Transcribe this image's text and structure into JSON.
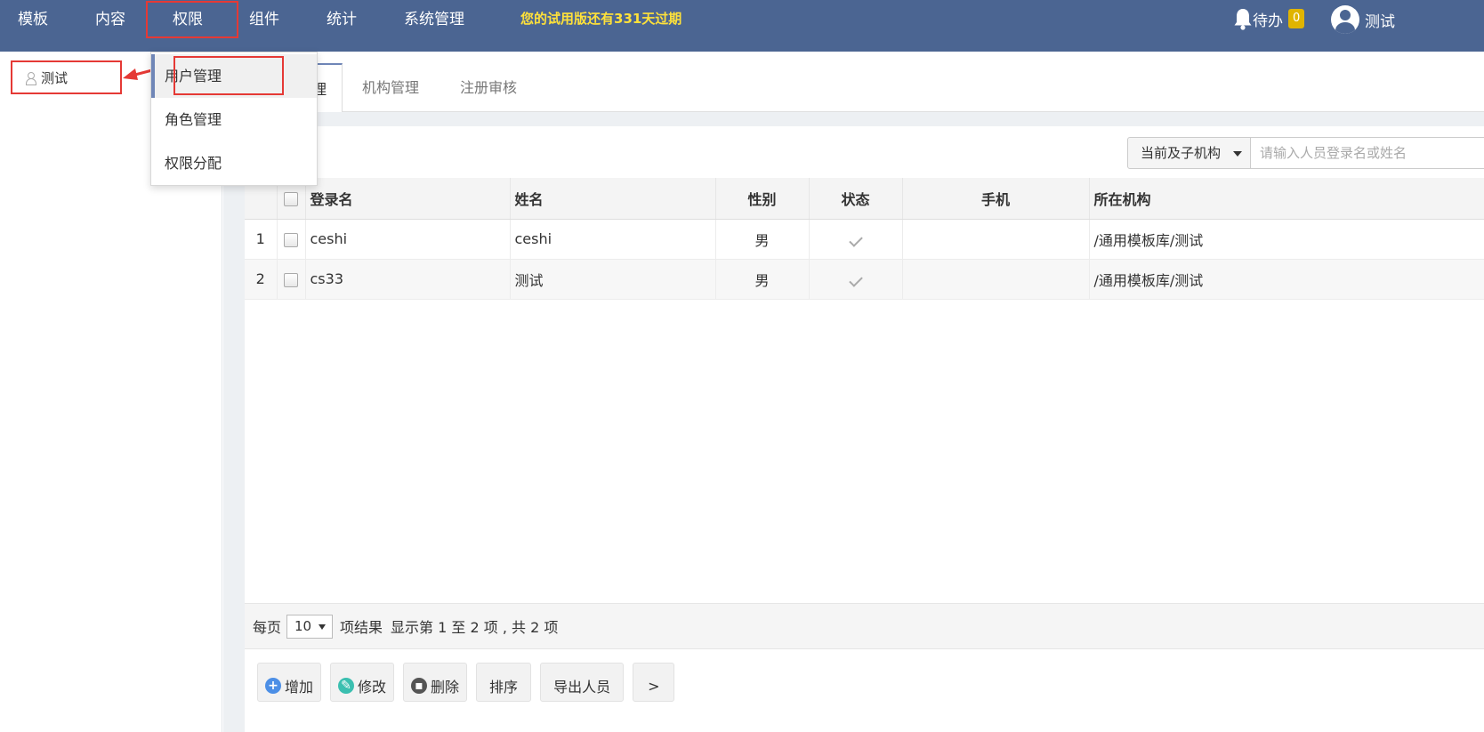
{
  "nav": {
    "items": [
      {
        "label": "模板"
      },
      {
        "label": "内容"
      },
      {
        "label": "权限"
      },
      {
        "label": "组件"
      },
      {
        "label": "统计"
      },
      {
        "label": "系统管理"
      }
    ],
    "trial_notice": "您的试用版还有331天过期",
    "todo_label": "待办",
    "todo_count": "0",
    "user_name": "测试"
  },
  "tree": {
    "node_label": "测试"
  },
  "dropdown": {
    "items": [
      {
        "label": "用户管理"
      },
      {
        "label": "角色管理"
      },
      {
        "label": "权限分配"
      }
    ]
  },
  "tabs": [
    {
      "label": "理"
    },
    {
      "label": "机构管理"
    },
    {
      "label": "注册审核"
    }
  ],
  "search": {
    "scope_value": "当前及子机构",
    "placeholder": "请输入人员登录名或姓名"
  },
  "table": {
    "headers": [
      "登录名",
      "姓名",
      "性别",
      "状态",
      "手机",
      "所在机构"
    ],
    "rows": [
      {
        "index": "1",
        "login": "ceshi",
        "name": "ceshi",
        "gender": "男",
        "status": "enabled",
        "phone": "",
        "org": "/通用模板库/测试"
      },
      {
        "index": "2",
        "login": "cs33",
        "name": "测试",
        "gender": "男",
        "status": "enabled",
        "phone": "",
        "org": "/通用模板库/测试"
      }
    ]
  },
  "pager": {
    "per_page_label": "每页",
    "per_page_value": "10",
    "result_label": "项结果",
    "summary": "显示第 1 至 2 项 , 共 2 项"
  },
  "toolbar": {
    "add": "增加",
    "edit": "修改",
    "delete": "删除",
    "sort": "排序",
    "export": "导出人员",
    "more": ">"
  },
  "colors": {
    "topbar": "#4b6592",
    "trial_notice": "#ffe13a",
    "badge": "#e0b400",
    "highlight": "#e53935"
  }
}
